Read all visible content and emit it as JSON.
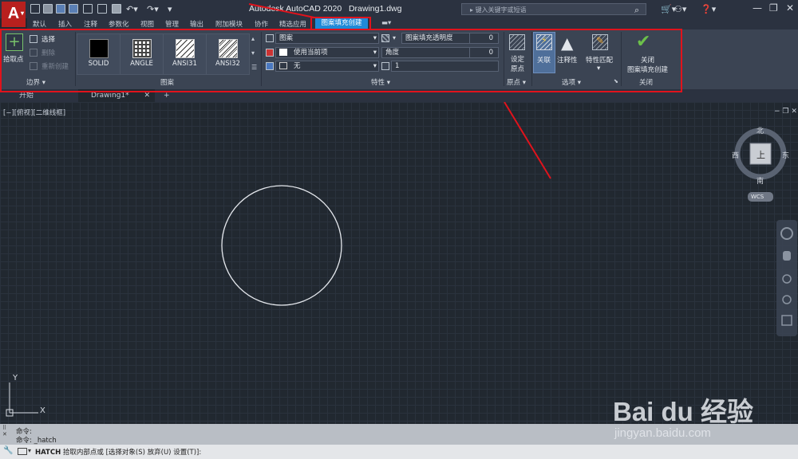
{
  "app": {
    "title": "Autodesk AutoCAD 2020",
    "file": "Drawing1.dwg",
    "logo": "A",
    "search_placeholder": "键入关键字或短语"
  },
  "tabs": [
    "默认",
    "插入",
    "注释",
    "参数化",
    "视图",
    "管理",
    "输出",
    "附加模块",
    "协作",
    "精选应用",
    "图案填充创建"
  ],
  "ribbon": {
    "boundary": {
      "title": "边界",
      "pick": "拾取点",
      "select": "选择",
      "remove": "删除",
      "recreate": "重新创建"
    },
    "pattern": {
      "title": "图案",
      "tiles": [
        "SOLID",
        "ANGLE",
        "ANSI31",
        "ANSI32"
      ]
    },
    "properties": {
      "title": "特性",
      "type": "图案",
      "color": "使用当前项",
      "bg": "无",
      "transparency_label": "图案填充透明度",
      "transparency": "0",
      "angle_label": "角度",
      "angle": "0",
      "scale": "1"
    },
    "origin": {
      "title": "原点",
      "set": "设定",
      "set2": "原点"
    },
    "options": {
      "title": "选项",
      "assoc": "关联",
      "annot": "注释性",
      "match": "特性匹配"
    },
    "close": {
      "title": "关闭",
      "label1": "关闭",
      "label2": "图案填充创建"
    }
  },
  "filetabs": {
    "start": "开始",
    "drawing": "Drawing1*",
    "add": "+"
  },
  "viewport": {
    "label": "[−][俯视][二维线框]"
  },
  "viewcube": {
    "n": "北",
    "s": "南",
    "e": "东",
    "w": "西",
    "top": "上",
    "wcs": "WCS"
  },
  "ucs": {
    "x": "X",
    "y": "Y"
  },
  "command": {
    "history": [
      "命令:",
      "命令: _hatch"
    ],
    "prompt_cmd": "HATCH",
    "prompt_text": "拾取内部点或 [选择对象(S) 放弃(U) 设置(T)]:"
  },
  "watermark": {
    "brand": "Bai du 经验",
    "url": "jingyan.baidu.com"
  },
  "colors": {
    "accent": "#1f8ad8",
    "annotation": "#e0131c",
    "ribbon": "#3b4453",
    "canvas": "#212830"
  }
}
